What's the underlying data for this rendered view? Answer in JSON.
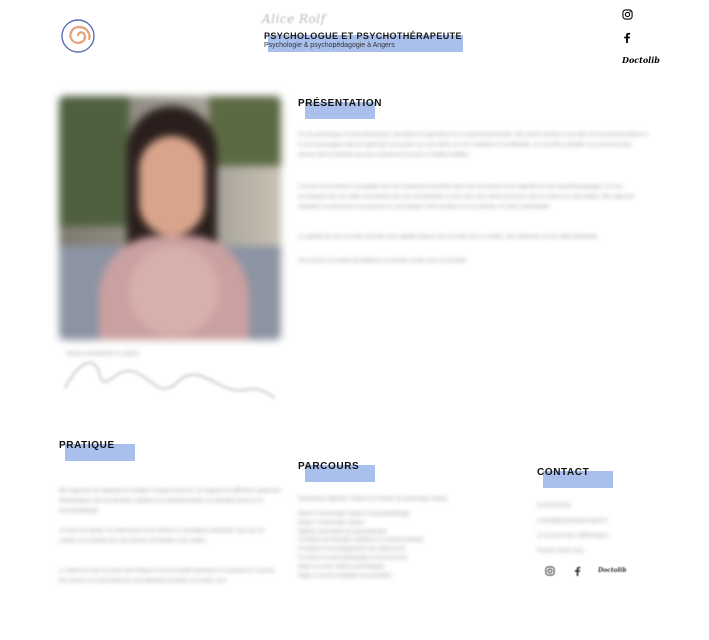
{
  "header": {
    "signature": "Alice Rolf",
    "title": "PSYCHOLOGUE ET PSYCHOTHÉRAPEUTE",
    "subtitle": "Psychologie & psychopédagogie à Angers",
    "doctolib": "Doctolib"
  },
  "icons": {
    "logo": "spiral-logo-icon",
    "instagram": "instagram-icon",
    "facebook": "facebook-icon"
  },
  "presentation": {
    "title": "PRÉSENTATION",
    "paragraphs": [
      "Je suis psychologue et psychothérapeute, spécialisée en approches et en comportement humain. Mon travail consiste à vous offrir une écoute bienveillante et à vous accompagner dans le regard que vous portez sur vous-même, sur vos conditions et vos difficultés. Je vous aide à identifier vos ressources pour avancer dans la direction qui vous correspond et trouver un meilleur équilibre.",
      "C'est lors de la première consultation que nous évaluerons ensemble quels sont vos besoins et les objectifs de notre travail thérapeutique. Je vous accompagne avec les outils et techniques qui vous correspondent, en lien avec votre rythme personnel, dans le respect de votre histoire. Mon approche intégrative me permet de vous proposer un suivi adapté à votre situation et à vos attentes, en toute confidentialité.",
      "La capacité de vous accorder du temps vous rappelle toujours que vous êtes pris en compte. Votre démarche est une étape importante.",
      "Vous pouvez me joindre par téléphone ou prendre rendez-vous sur Doctolib."
    ],
    "caption": "Séances individuelles en cabinet"
  },
  "pratique": {
    "title": "PRATIQUE",
    "paragraphs": [
      "Mon approche est intégrative et s'adapte à chaque personne. Je m'appuie sur différentes approches thérapeutiques dont les thérapies cognitives et comportementales, les thérapies brèves et la psychopédagogie.",
      "Je reçois les adultes, les adolescents et les enfants en consultation individuelle, ainsi que les couples et les familles pour des séances de thérapie et de soutien.",
      "Le cabinet se situe au centre ville d'Angers et est accessible facilement en transports en commun. Des séances en visioconférence sont également possibles sur rendez-vous."
    ]
  },
  "parcours": {
    "title": "PARCOURS",
    "intro": "Psychologue diplômée, titulaire d'un Master de psychologie clinique.",
    "items": [
      "Master 2 Psychologie clinique et psychopathologie",
      "Master 1 Psychologie clinique",
      "Diplôme universitaire de psychothérapie",
      "Formation aux thérapies cognitives et comportementales",
      "Formation à l'accompagnement des adolescents",
      "Formation en psychopédagogie et neurosciences",
      "Stage au centre médico-psychologique",
      "Stage en service hospitalier de psychiatrie"
    ]
  },
  "contact": {
    "title": "CONTACT",
    "lines": [
      "06 00 00 00 00",
      "contact@psychologue-angers.fr",
      "12 rue de la Paix, 49000 Angers",
      "Prendre rendez-vous"
    ],
    "doctolib": "Doctolib"
  }
}
